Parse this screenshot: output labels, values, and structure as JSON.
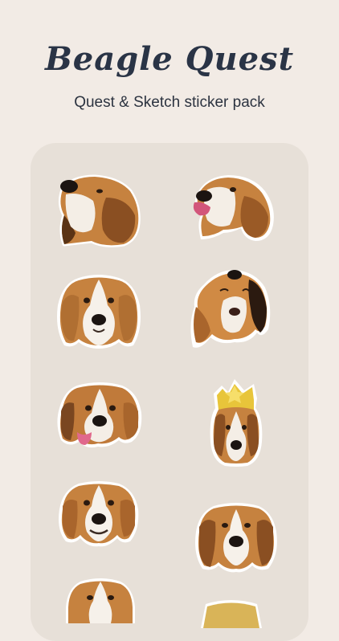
{
  "header": {
    "title": "Beagle Quest",
    "subtitle": "Quest & Sketch sticker pack"
  },
  "stickers": [
    {
      "name": "beagle-sniffing-up",
      "icon": "beagle-sticker"
    },
    {
      "name": "beagle-licking-nose",
      "icon": "beagle-sticker"
    },
    {
      "name": "beagle-front-face",
      "icon": "beagle-sticker"
    },
    {
      "name": "beagle-howling",
      "icon": "beagle-sticker"
    },
    {
      "name": "beagle-tongue-out",
      "icon": "beagle-sticker"
    },
    {
      "name": "beagle-with-crown",
      "icon": "crown-beagle-sticker"
    },
    {
      "name": "beagle-smiling",
      "icon": "beagle-sticker"
    },
    {
      "name": "beagle-sad-face",
      "icon": "beagle-sticker"
    },
    {
      "name": "beagle-partial-left",
      "icon": "beagle-sticker"
    },
    {
      "name": "beagle-partial-right",
      "icon": "beagle-sticker"
    }
  ],
  "colors": {
    "background": "#f2ebe5",
    "panel": "#e7e0d8",
    "title": "#2a3446",
    "fur_tan": "#c6823f",
    "fur_dark": "#8a4f22",
    "crown": "#e8c53a"
  }
}
